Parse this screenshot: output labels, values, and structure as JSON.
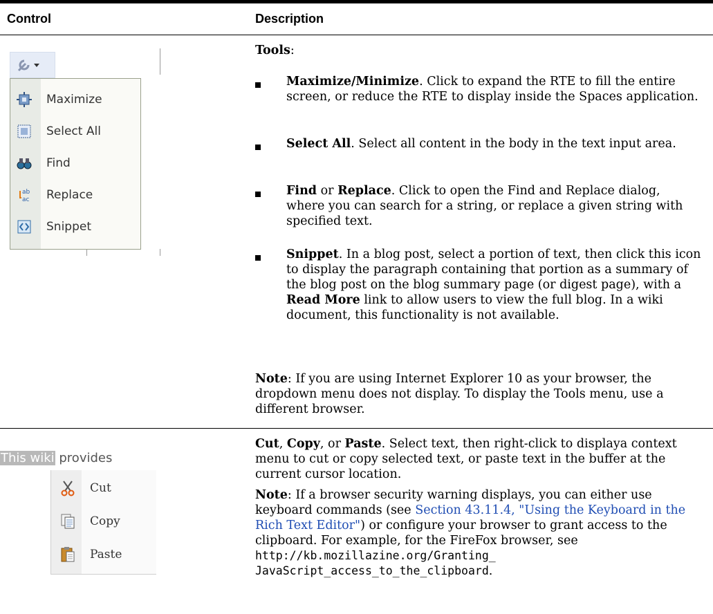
{
  "table": {
    "headers": {
      "control": "Control",
      "description": "Description"
    }
  },
  "row1": {
    "title": "Tools",
    "menu_items": [
      {
        "label": "Maximize",
        "icon": "maximize-icon"
      },
      {
        "label": "Select All",
        "icon": "select-all-icon"
      },
      {
        "label": "Find",
        "icon": "binoculars-icon"
      },
      {
        "label": "Replace",
        "icon": "replace-icon"
      },
      {
        "label": "Snippet",
        "icon": "snippet-icon"
      }
    ],
    "bullets": [
      {
        "bold": "Maximize/Minimize",
        "text": ". Click to expand the RTE to fill the entire screen, or reduce the RTE to display inside the Spaces application."
      },
      {
        "bold": "Select All",
        "text": ". Select all content in the body in the text input area."
      },
      {
        "bold": "Find",
        "mid": " or ",
        "bold2": "Replace",
        "text": ". Click to open the Find and Replace dialog, where you can search for a string, or replace a given string with specified text."
      },
      {
        "bold": "Snippet",
        "text": ". In a blog post, select a portion of text, then click this icon to display the paragraph containing that portion as a summary of the blog post on the blog summary page (or digest page), with a ",
        "bold2": "Read More",
        "text2": " link to allow users to view the full blog. In a wiki document, this functionality is not available."
      }
    ],
    "note_label": "Note",
    "note_text": ": If you are using Internet Explorer 10 as your browser, the dropdown menu does not display.  To display the Tools menu, use a different browser."
  },
  "row2": {
    "sample_text_highlighted": "This wiki",
    "sample_text_rest": " provides",
    "menu_items": [
      {
        "label": "Cut",
        "icon": "scissors-icon"
      },
      {
        "label": "Copy",
        "icon": "copy-icon"
      },
      {
        "label": "Paste",
        "icon": "paste-icon"
      }
    ],
    "cut": "Cut",
    "copy": "Copy",
    "paste": "Paste",
    "sep1": ", ",
    "sep2": ", or ",
    "desc": ". Select text, then right-click to displaya context menu to cut or copy selected text, or paste text in the buffer at the current cursor location.",
    "note_label": "Note",
    "note_pre": ":  If a browser security warning displays, you can either use keyboard commands (see ",
    "note_link": "Section 43.11.4, \"Using the Keyboard in the Rich Text Editor\"",
    "note_mid": ") or configure your browser to grant access to the clipboard. For example, for the FireFox browser, see ",
    "note_url_1": "http://kb.mozillazine.org/Granting_",
    "note_url_2": "JavaScript_access_to_the_clipboard",
    "note_end": "."
  },
  "colors": {
    "link": "#1f4db3",
    "rule": "#000000"
  }
}
